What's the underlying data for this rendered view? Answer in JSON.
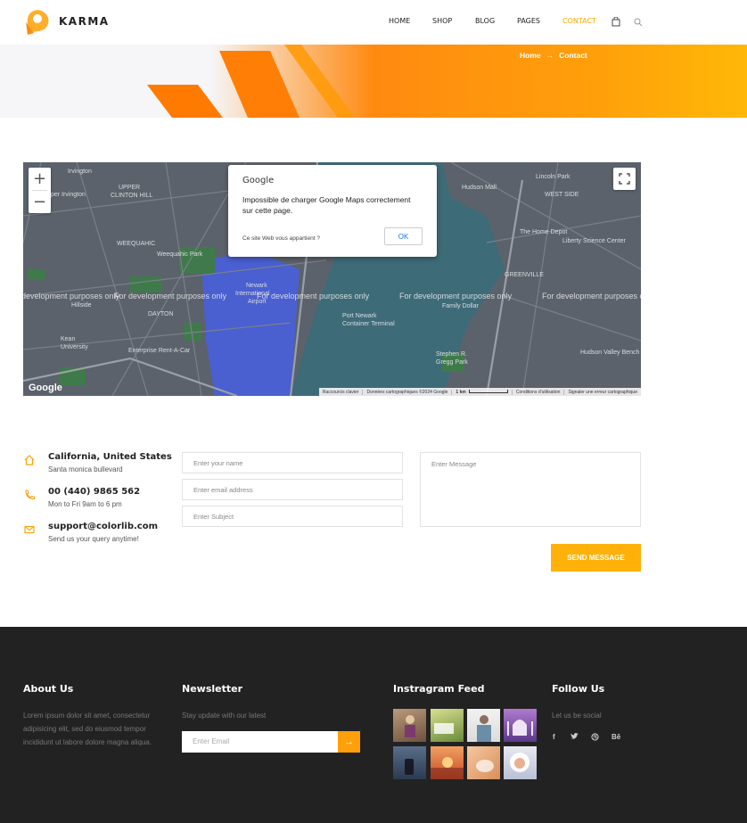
{
  "header": {
    "brand": "KARMA",
    "nav": [
      {
        "label": "HOME",
        "active": false
      },
      {
        "label": "SHOP",
        "active": false
      },
      {
        "label": "BLOG",
        "active": false
      },
      {
        "label": "PAGES",
        "active": false
      },
      {
        "label": "CONTACT",
        "active": true
      }
    ],
    "icons": [
      "shopping-bag-icon",
      "search-icon"
    ],
    "accent": "#ffa500"
  },
  "breadcrumb": {
    "home": "Home",
    "separator_icon": "arrow-right-icon",
    "current": "Contact"
  },
  "map": {
    "zoom_in": "+",
    "zoom_out": "−",
    "dialog": {
      "brand": "Google",
      "message": "Impossible de charger Google Maps correctement sur cette page.",
      "owner_question": "Ce site Web vous appartient ?",
      "ok_label": "OK"
    },
    "watermark": "For development purposes only",
    "logo": "Google",
    "attribution": {
      "shortcuts": "Raccourcis clavier",
      "data": "Données cartographiques ©2024 Google",
      "scale": "1 km",
      "terms": "Conditions d'utilisation",
      "report": "Signaler une erreur cartographique"
    },
    "labels": [
      "Irvington",
      "UPPER CLINTON HILL",
      "Upper Irvington",
      "WEEQUAHIC",
      "Weequahic Park",
      "Hillside",
      "DAYTON",
      "Kean University",
      "Enterprise Rent-A-Car",
      "Newark International Airport",
      "Port Newark Container Terminal",
      "Hudson Mall",
      "Lincoln Park",
      "WEST SIDE",
      "The Home Depot",
      "Liberty Science Center",
      "GREENVILLE",
      "Family Dollar",
      "Stephen R. Gregg Park",
      "Hudson Valley Bench"
    ]
  },
  "contact": {
    "address": {
      "title": "California, United States",
      "sub": "Santa monica bullevard",
      "icon": "home-icon"
    },
    "phone": {
      "title": "00 (440) 9865 562",
      "sub": "Mon to Fri 9am to 6 pm",
      "icon": "phone-icon"
    },
    "email": {
      "title": "support@colorlib.com",
      "sub": "Send us your query anytime!",
      "icon": "mail-icon"
    },
    "form": {
      "name_placeholder": "Enter your name",
      "email_placeholder": "Enter email address",
      "subject_placeholder": "Enter Subject",
      "message_placeholder": "Enter Message",
      "submit": "SEND MESSAGE"
    }
  },
  "footer": {
    "about": {
      "title": "About Us",
      "text": "Lorem ipsum dolor sit amet, consectetur adipisicing elit, sed do eiusmod tempor incididunt ut labore dolore magna aliqua."
    },
    "newsletter": {
      "title": "Newsletter",
      "text": "Stay update with our latest",
      "placeholder": "Enter Email",
      "button_icon": "arrow-right-icon"
    },
    "instagram": {
      "title": "Instragram Feed",
      "count": 8
    },
    "follow": {
      "title": "Follow Us",
      "text": "Let us be social",
      "icons": [
        "f",
        "twitter-icon",
        "dribbble-icon",
        "Bē"
      ]
    }
  }
}
